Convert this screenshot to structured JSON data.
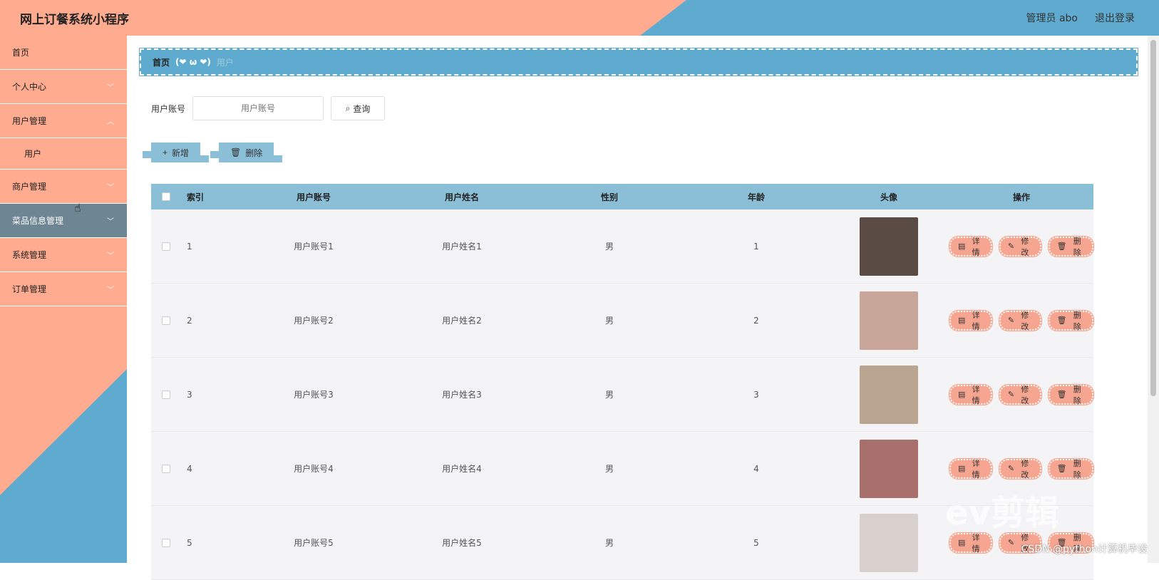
{
  "app": {
    "title": "网上订餐系统小程序"
  },
  "header": {
    "user": "管理员 abo",
    "logout": "退出登录"
  },
  "sidebar": {
    "items": [
      {
        "label": "首页",
        "chevron": false
      },
      {
        "label": "个人中心",
        "chevron": true
      },
      {
        "label": "用户管理",
        "chevron": true,
        "expanded": true
      },
      {
        "label": "用户",
        "sub": true
      },
      {
        "label": "商户管理",
        "chevron": true
      },
      {
        "label": "菜品信息管理",
        "chevron": true,
        "active": true
      },
      {
        "label": "系统管理",
        "chevron": true
      },
      {
        "label": "订单管理",
        "chevron": true
      }
    ]
  },
  "breadcrumb": {
    "home": "首页",
    "separator": "(❤ ω ❤)",
    "current": "用户"
  },
  "search": {
    "label": "用户账号",
    "placeholder": "用户账号",
    "button": "查询"
  },
  "actions": {
    "add": "新增",
    "delete": "删除"
  },
  "table": {
    "headers": {
      "index": "索引",
      "account": "用户账号",
      "name": "用户姓名",
      "sex": "性别",
      "age": "年龄",
      "avatar": "头像",
      "ops": "操作"
    },
    "ops": {
      "detail": "详情",
      "edit": "修改",
      "delete": "删除"
    },
    "rows": [
      {
        "index": "1",
        "account": "用户账号1",
        "name": "用户姓名1",
        "sex": "男",
        "age": "1"
      },
      {
        "index": "2",
        "account": "用户账号2",
        "name": "用户姓名2",
        "sex": "男",
        "age": "2"
      },
      {
        "index": "3",
        "account": "用户账号3",
        "name": "用户姓名3",
        "sex": "男",
        "age": "3"
      },
      {
        "index": "4",
        "account": "用户账号4",
        "name": "用户姓名4",
        "sex": "男",
        "age": "4"
      },
      {
        "index": "5",
        "account": "用户账号5",
        "name": "用户姓名5",
        "sex": "男",
        "age": "5"
      }
    ]
  },
  "watermark": "CSDN @python计算机毕设",
  "logo": "ev剪辑",
  "colors": {
    "salmon": "#ffab90",
    "blue": "#5eabcf",
    "light_blue": "#8bbfd8",
    "active_menu": "#6e8593",
    "op_button": "#f6a590"
  }
}
